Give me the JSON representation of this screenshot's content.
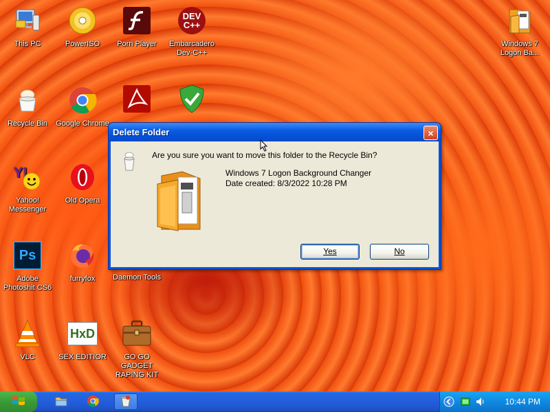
{
  "desktop": {
    "icons": [
      {
        "label": "This PC",
        "icon": "computer-icon"
      },
      {
        "label": "PowerISO",
        "icon": "disc-icon"
      },
      {
        "label": "Porn Player",
        "icon": "flash-icon"
      },
      {
        "label": "Embarcadero Dev-C++",
        "icon": "devcpp-icon",
        "glyph": "DEV\nC++"
      },
      {
        "label": "Windows 7 Logon Ba...",
        "icon": "folder-icon"
      },
      {
        "label": "Recycle Bin",
        "icon": "recycle-bin-icon"
      },
      {
        "label": "Google Chrome",
        "icon": "chrome-icon"
      },
      {
        "label": "Adobe Photoshit CS6",
        "icon": "photoshop-icon",
        "glyph": "Ps"
      },
      {
        "label": "furryfox",
        "icon": "firefox-icon"
      },
      {
        "label": "Daemon Tools",
        "icon": "daemon-tools-icon"
      },
      {
        "label": "Yahoo! Messenger",
        "icon": "yahoo-messenger-icon"
      },
      {
        "label": "Old Opera",
        "icon": "opera-icon"
      },
      {
        "label": "VLC",
        "icon": "vlc-icon"
      },
      {
        "label": "SEX EDITIOR",
        "icon": "hxd-icon",
        "glyph": "HxD"
      },
      {
        "label": "GO GO GADGET RAPING KIT",
        "icon": "briefcase-icon"
      }
    ]
  },
  "dialog": {
    "title": "Delete Folder",
    "question": "Are you sure you want to move this folder to the Recycle Bin?",
    "folder_name": "Windows 7 Logon Background Changer",
    "date_created": "Date created: 8/3/2022 10:28 PM",
    "yes_label": "Yes",
    "no_label": "No",
    "close_label": "×"
  },
  "taskbar": {
    "clock": "10:44 PM"
  },
  "colors": {
    "titlebar": "#0a5de4",
    "dialog_body": "#ece9d8",
    "taskbar": "#245edb",
    "tray": "#0f8ae0",
    "start": "#3c9a3a"
  }
}
